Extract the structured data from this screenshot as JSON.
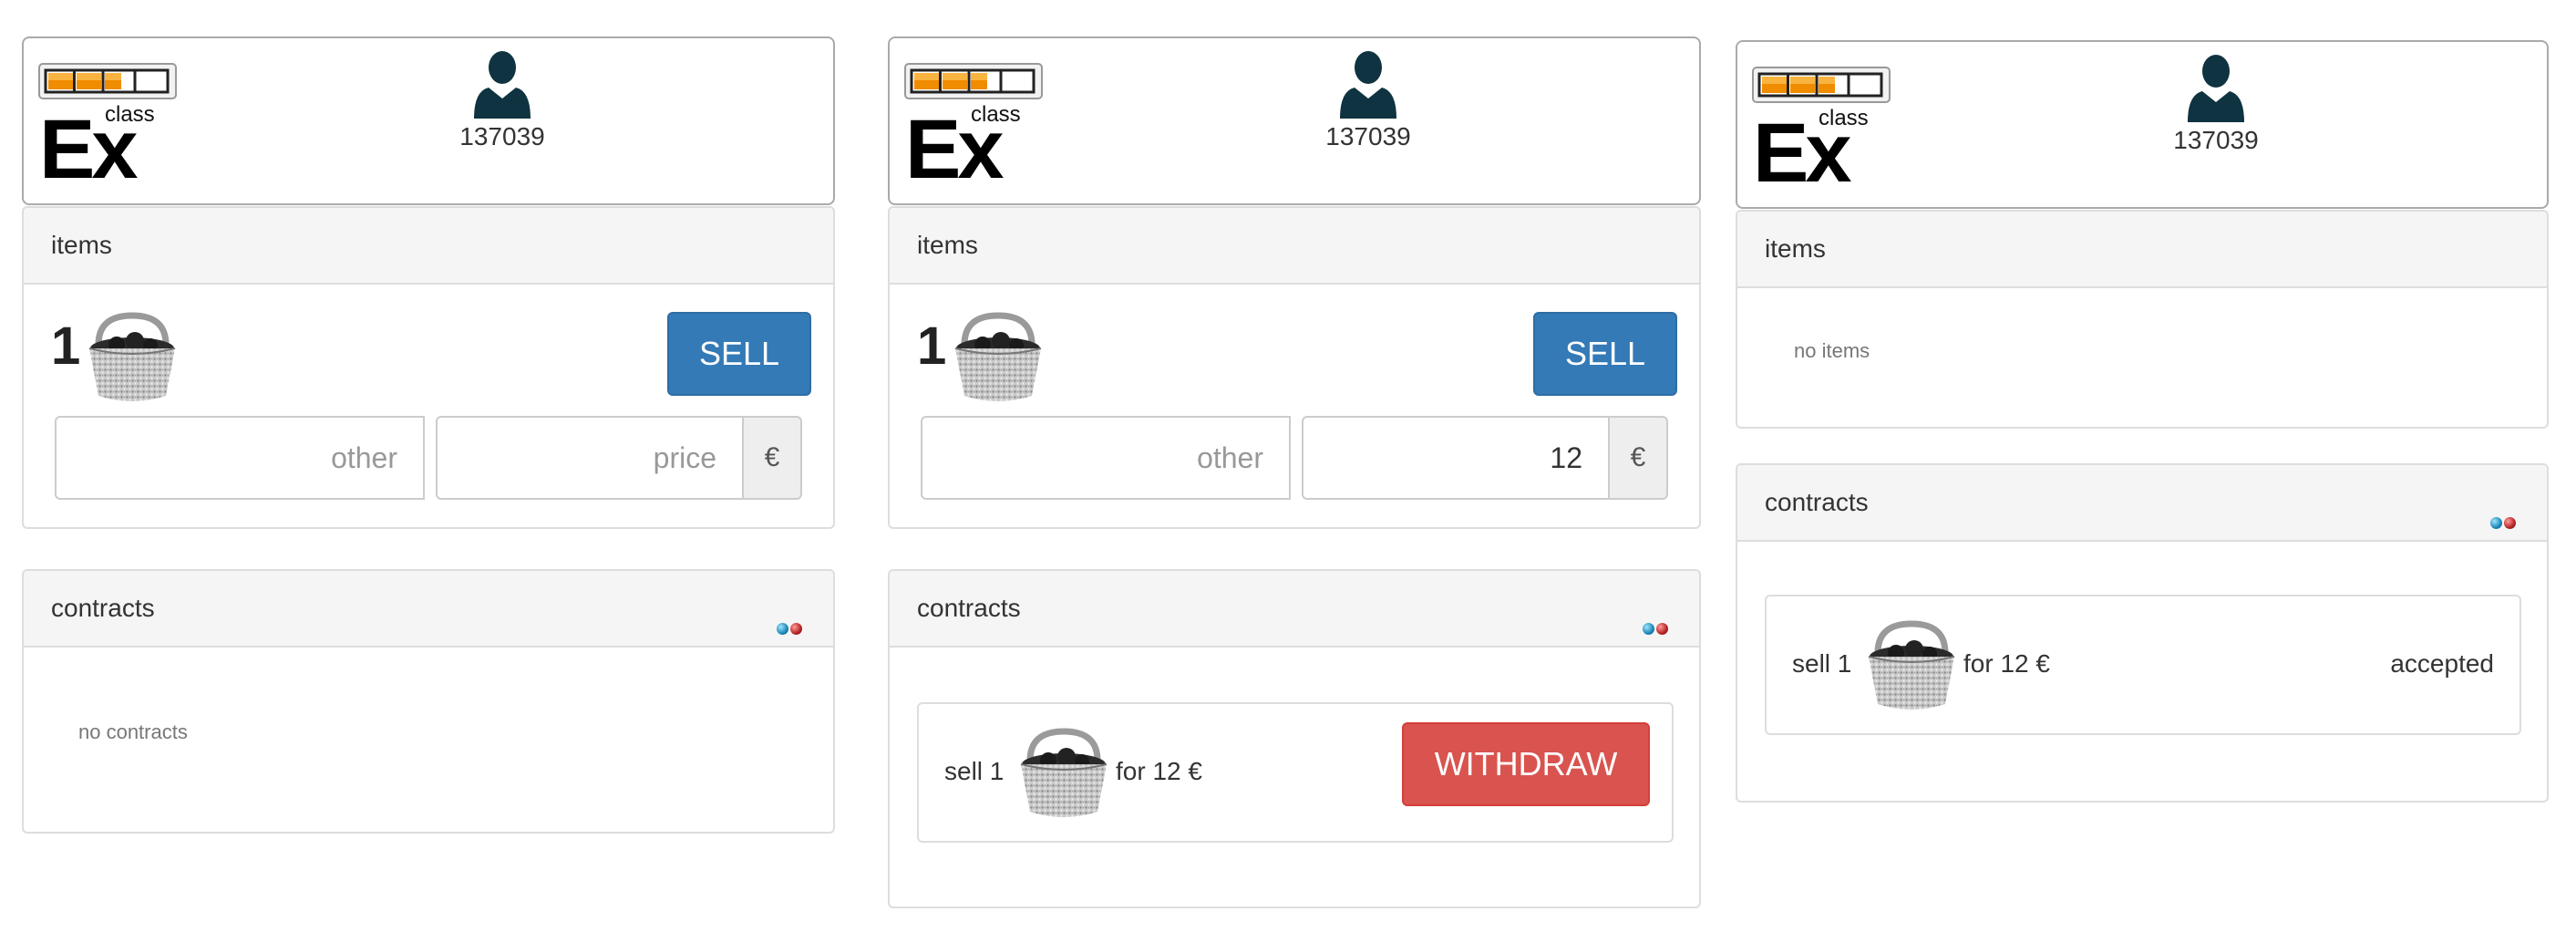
{
  "screens": [
    {
      "user_id": "137039",
      "items_title": "items",
      "item_qty": "1",
      "sell_label": "SELL",
      "other_placeholder": "other",
      "price_placeholder": "price",
      "price_value": "",
      "currency": "€",
      "contracts_title": "contracts",
      "no_contracts": "no contracts"
    },
    {
      "user_id": "137039",
      "items_title": "items",
      "item_qty": "1",
      "sell_label": "SELL",
      "other_placeholder": "other",
      "price_placeholder": "price",
      "price_value": "12",
      "currency": "€",
      "contracts_title": "contracts",
      "contract": {
        "sell": "sell 1",
        "for": "for 12 €",
        "withdraw_label": "WITHDRAW"
      }
    },
    {
      "user_id": "137039",
      "items_title": "items",
      "no_items": "no items",
      "contracts_title": "contracts",
      "contract": {
        "sell": "sell 1",
        "for": "for 12 €",
        "status": "accepted"
      }
    }
  ],
  "logo": {
    "small": "class",
    "big": "Ex"
  },
  "colors": {
    "primary": "#337ab7",
    "danger": "#d9534f",
    "accent": "#f08c00"
  },
  "icons": [
    "logo-icon",
    "user-icon",
    "basket-icon",
    "status-dot-blue",
    "status-dot-red"
  ]
}
